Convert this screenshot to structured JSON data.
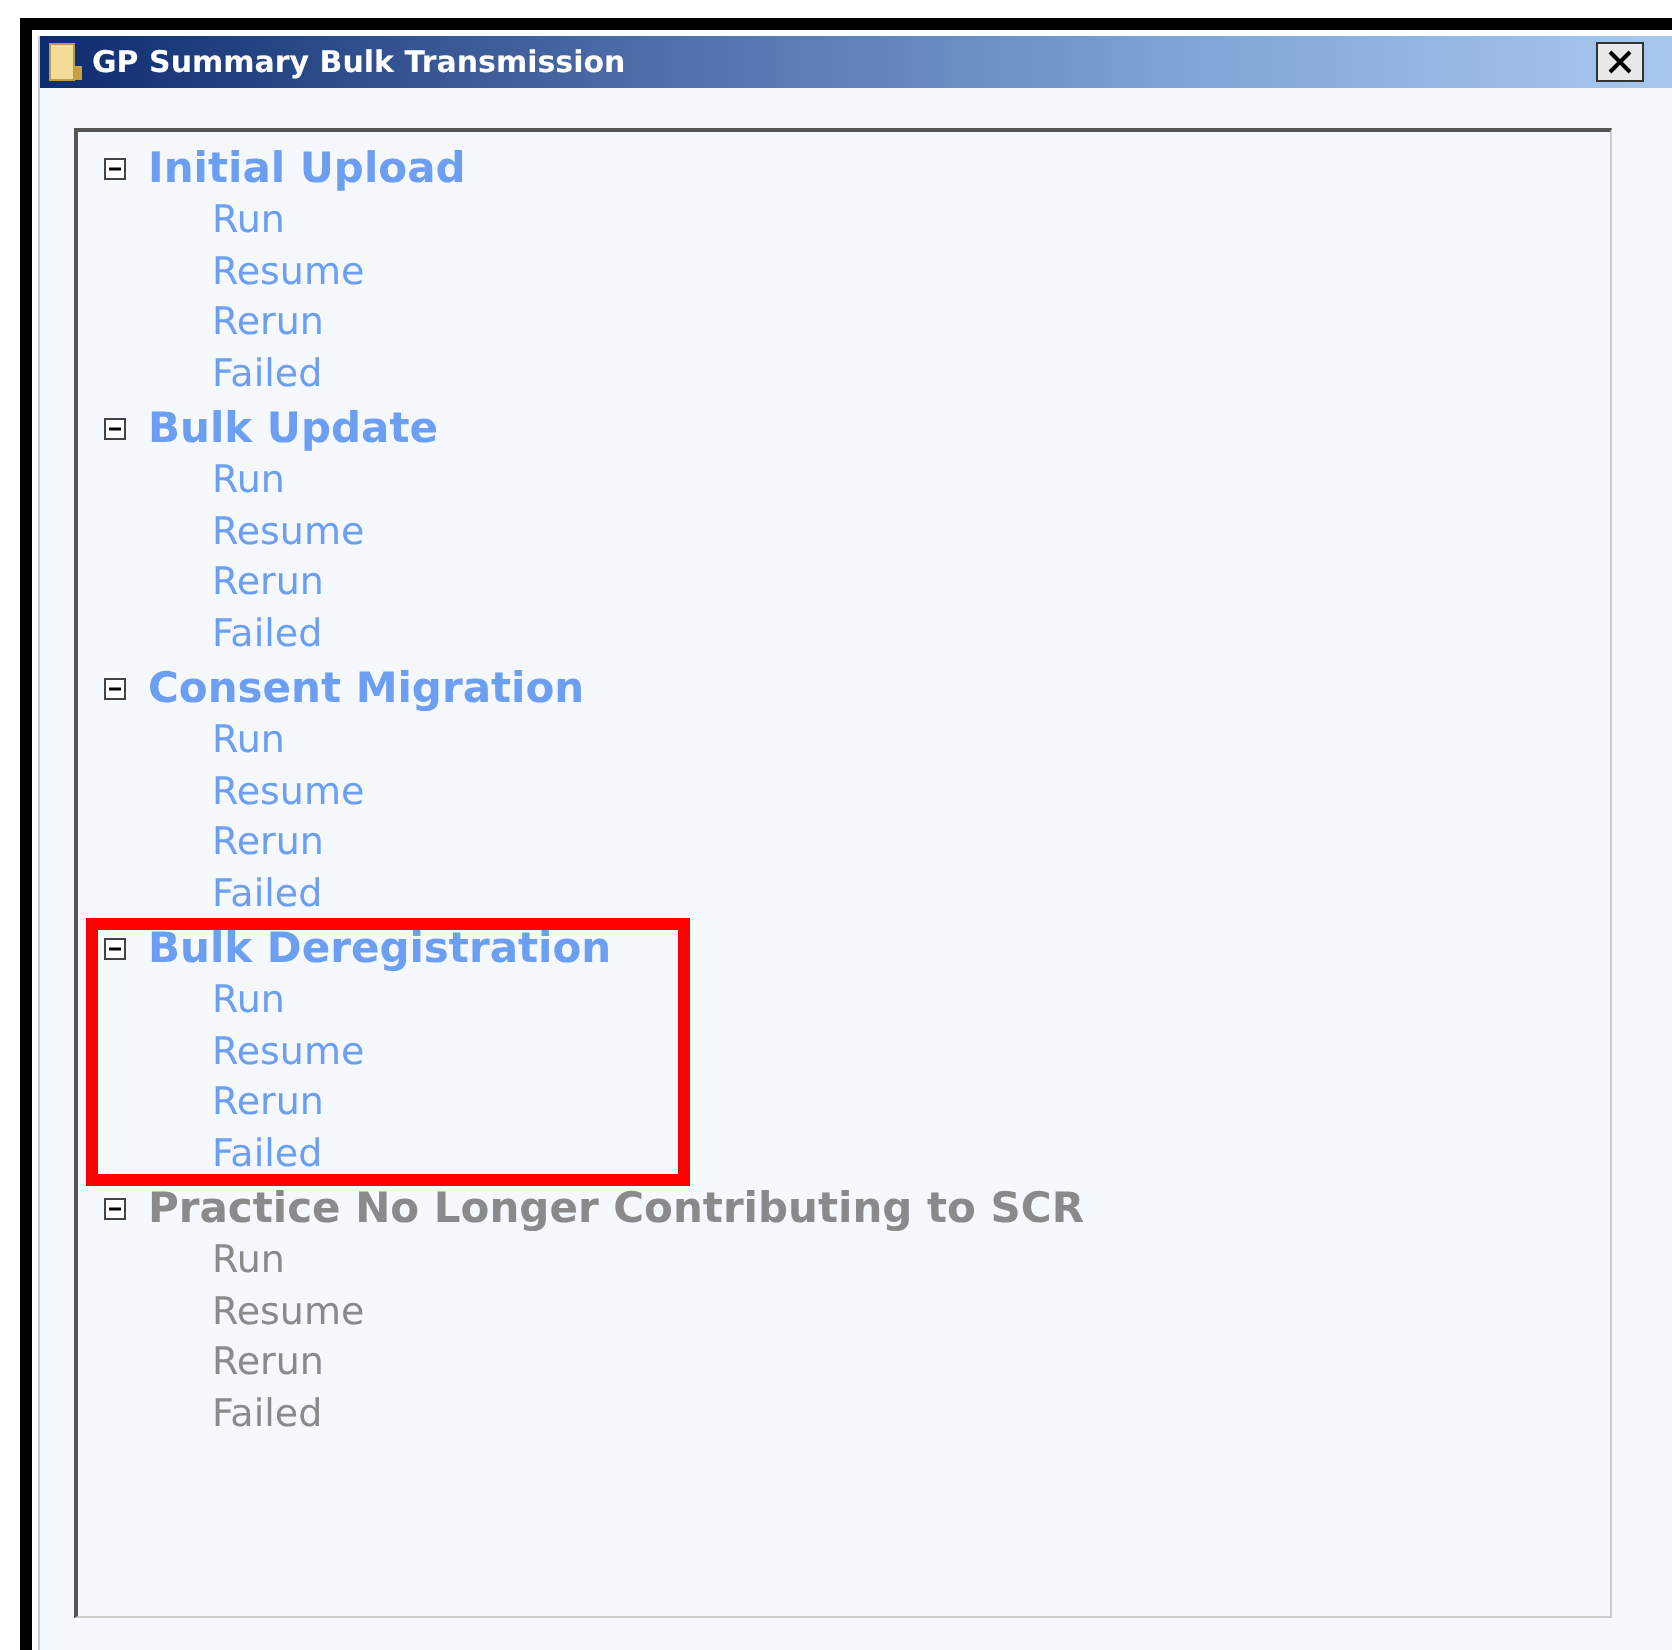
{
  "window": {
    "title": "GP Summary Bulk Transmission"
  },
  "groups": [
    {
      "title": "Initial Upload",
      "expanded": true,
      "disabled": false,
      "highlighted": false,
      "items": [
        "Run",
        "Resume",
        "Rerun",
        "Failed"
      ]
    },
    {
      "title": "Bulk Update",
      "expanded": true,
      "disabled": false,
      "highlighted": false,
      "items": [
        "Run",
        "Resume",
        "Rerun",
        "Failed"
      ]
    },
    {
      "title": "Consent Migration",
      "expanded": true,
      "disabled": false,
      "highlighted": false,
      "items": [
        "Run",
        "Resume",
        "Rerun",
        "Failed"
      ]
    },
    {
      "title": "Bulk Deregistration",
      "expanded": true,
      "disabled": false,
      "highlighted": true,
      "items": [
        "Run",
        "Resume",
        "Rerun",
        "Failed"
      ]
    },
    {
      "title": "Practice No Longer Contributing to SCR",
      "expanded": true,
      "disabled": true,
      "highlighted": false,
      "items": [
        "Run",
        "Resume",
        "Rerun",
        "Failed"
      ]
    }
  ]
}
